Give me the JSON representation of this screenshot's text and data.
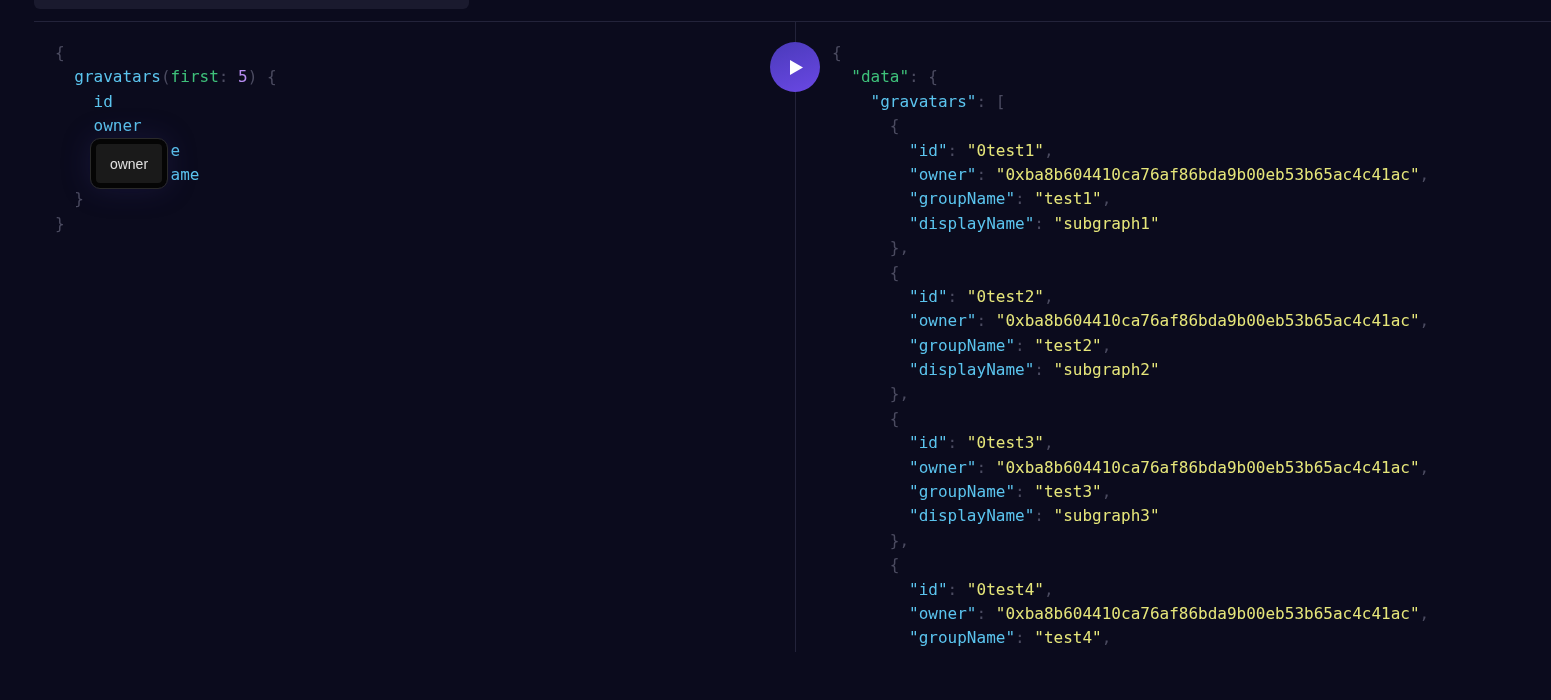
{
  "query_editor": {
    "lines": [
      [
        {
          "kind": "punct",
          "text": "{"
        }
      ],
      [
        {
          "kind": "field",
          "text": "  gravatars"
        },
        {
          "kind": "punct",
          "text": "("
        },
        {
          "kind": "arg",
          "text": "first"
        },
        {
          "kind": "punct",
          "text": ": "
        },
        {
          "kind": "number",
          "text": "5"
        },
        {
          "kind": "punct",
          "text": ") {"
        }
      ],
      [
        {
          "kind": "field",
          "text": "    id"
        }
      ],
      [
        {
          "kind": "field",
          "text": "    owner"
        }
      ],
      [
        {
          "kind": "fragment",
          "text": "e"
        }
      ],
      [
        {
          "kind": "fragment",
          "text": "ame"
        }
      ],
      [
        {
          "kind": "punct",
          "text": "  }"
        }
      ],
      [
        {
          "kind": "punct",
          "text": "}"
        }
      ]
    ],
    "tooltip": "owner"
  },
  "run_button": {
    "kind": "play"
  },
  "result": {
    "lines": [
      [
        {
          "kind": "punct",
          "text": "{"
        }
      ],
      [
        {
          "kind": "rootkey",
          "text": "  \"data\""
        },
        {
          "kind": "punct",
          "text": ": {"
        }
      ],
      [
        {
          "kind": "key",
          "text": "    \"gravatars\""
        },
        {
          "kind": "punct",
          "text": ": ["
        }
      ],
      [
        {
          "kind": "punct",
          "text": "      {"
        }
      ],
      [
        {
          "kind": "key",
          "text": "        \"id\""
        },
        {
          "kind": "punct",
          "text": ": "
        },
        {
          "kind": "string",
          "text": "\"0test1\""
        },
        {
          "kind": "punct",
          "text": ","
        }
      ],
      [
        {
          "kind": "key",
          "text": "        \"owner\""
        },
        {
          "kind": "punct",
          "text": ": "
        },
        {
          "kind": "string",
          "text": "\"0xba8b604410ca76af86bda9b00eb53b65ac4c41ac\""
        },
        {
          "kind": "punct",
          "text": ","
        }
      ],
      [
        {
          "kind": "key",
          "text": "        \"groupName\""
        },
        {
          "kind": "punct",
          "text": ": "
        },
        {
          "kind": "string",
          "text": "\"test1\""
        },
        {
          "kind": "punct",
          "text": ","
        }
      ],
      [
        {
          "kind": "key",
          "text": "        \"displayName\""
        },
        {
          "kind": "punct",
          "text": ": "
        },
        {
          "kind": "string",
          "text": "\"subgraph1\""
        }
      ],
      [
        {
          "kind": "punct",
          "text": "      },"
        }
      ],
      [
        {
          "kind": "punct",
          "text": "      {"
        }
      ],
      [
        {
          "kind": "key",
          "text": "        \"id\""
        },
        {
          "kind": "punct",
          "text": ": "
        },
        {
          "kind": "string",
          "text": "\"0test2\""
        },
        {
          "kind": "punct",
          "text": ","
        }
      ],
      [
        {
          "kind": "key",
          "text": "        \"owner\""
        },
        {
          "kind": "punct",
          "text": ": "
        },
        {
          "kind": "string",
          "text": "\"0xba8b604410ca76af86bda9b00eb53b65ac4c41ac\""
        },
        {
          "kind": "punct",
          "text": ","
        }
      ],
      [
        {
          "kind": "key",
          "text": "        \"groupName\""
        },
        {
          "kind": "punct",
          "text": ": "
        },
        {
          "kind": "string",
          "text": "\"test2\""
        },
        {
          "kind": "punct",
          "text": ","
        }
      ],
      [
        {
          "kind": "key",
          "text": "        \"displayName\""
        },
        {
          "kind": "punct",
          "text": ": "
        },
        {
          "kind": "string",
          "text": "\"subgraph2\""
        }
      ],
      [
        {
          "kind": "punct",
          "text": "      },"
        }
      ],
      [
        {
          "kind": "punct",
          "text": "      {"
        }
      ],
      [
        {
          "kind": "key",
          "text": "        \"id\""
        },
        {
          "kind": "punct",
          "text": ": "
        },
        {
          "kind": "string",
          "text": "\"0test3\""
        },
        {
          "kind": "punct",
          "text": ","
        }
      ],
      [
        {
          "kind": "key",
          "text": "        \"owner\""
        },
        {
          "kind": "punct",
          "text": ": "
        },
        {
          "kind": "string",
          "text": "\"0xba8b604410ca76af86bda9b00eb53b65ac4c41ac\""
        },
        {
          "kind": "punct",
          "text": ","
        }
      ],
      [
        {
          "kind": "key",
          "text": "        \"groupName\""
        },
        {
          "kind": "punct",
          "text": ": "
        },
        {
          "kind": "string",
          "text": "\"test3\""
        },
        {
          "kind": "punct",
          "text": ","
        }
      ],
      [
        {
          "kind": "key",
          "text": "        \"displayName\""
        },
        {
          "kind": "punct",
          "text": ": "
        },
        {
          "kind": "string",
          "text": "\"subgraph3\""
        }
      ],
      [
        {
          "kind": "punct",
          "text": "      },"
        }
      ],
      [
        {
          "kind": "punct",
          "text": "      {"
        }
      ],
      [
        {
          "kind": "key",
          "text": "        \"id\""
        },
        {
          "kind": "punct",
          "text": ": "
        },
        {
          "kind": "string",
          "text": "\"0test4\""
        },
        {
          "kind": "punct",
          "text": ","
        }
      ],
      [
        {
          "kind": "key",
          "text": "        \"owner\""
        },
        {
          "kind": "punct",
          "text": ": "
        },
        {
          "kind": "string",
          "text": "\"0xba8b604410ca76af86bda9b00eb53b65ac4c41ac\""
        },
        {
          "kind": "punct",
          "text": ","
        }
      ],
      [
        {
          "kind": "key",
          "text": "        \"groupName\""
        },
        {
          "kind": "punct",
          "text": ": "
        },
        {
          "kind": "string",
          "text": "\"test4\""
        },
        {
          "kind": "punct",
          "text": ","
        }
      ]
    ]
  }
}
